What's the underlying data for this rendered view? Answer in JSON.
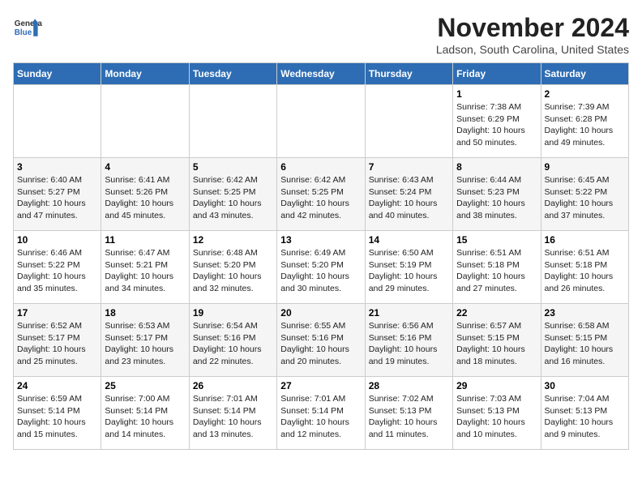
{
  "header": {
    "logo_line1": "General",
    "logo_line2": "Blue",
    "title": "November 2024",
    "subtitle": "Ladson, South Carolina, United States"
  },
  "calendar": {
    "days_of_week": [
      "Sunday",
      "Monday",
      "Tuesday",
      "Wednesday",
      "Thursday",
      "Friday",
      "Saturday"
    ],
    "weeks": [
      [
        {
          "day": "",
          "info": ""
        },
        {
          "day": "",
          "info": ""
        },
        {
          "day": "",
          "info": ""
        },
        {
          "day": "",
          "info": ""
        },
        {
          "day": "",
          "info": ""
        },
        {
          "day": "1",
          "info": "Sunrise: 7:38 AM\nSunset: 6:29 PM\nDaylight: 10 hours and 50 minutes."
        },
        {
          "day": "2",
          "info": "Sunrise: 7:39 AM\nSunset: 6:28 PM\nDaylight: 10 hours and 49 minutes."
        }
      ],
      [
        {
          "day": "3",
          "info": "Sunrise: 6:40 AM\nSunset: 5:27 PM\nDaylight: 10 hours and 47 minutes."
        },
        {
          "day": "4",
          "info": "Sunrise: 6:41 AM\nSunset: 5:26 PM\nDaylight: 10 hours and 45 minutes."
        },
        {
          "day": "5",
          "info": "Sunrise: 6:42 AM\nSunset: 5:25 PM\nDaylight: 10 hours and 43 minutes."
        },
        {
          "day": "6",
          "info": "Sunrise: 6:42 AM\nSunset: 5:25 PM\nDaylight: 10 hours and 42 minutes."
        },
        {
          "day": "7",
          "info": "Sunrise: 6:43 AM\nSunset: 5:24 PM\nDaylight: 10 hours and 40 minutes."
        },
        {
          "day": "8",
          "info": "Sunrise: 6:44 AM\nSunset: 5:23 PM\nDaylight: 10 hours and 38 minutes."
        },
        {
          "day": "9",
          "info": "Sunrise: 6:45 AM\nSunset: 5:22 PM\nDaylight: 10 hours and 37 minutes."
        }
      ],
      [
        {
          "day": "10",
          "info": "Sunrise: 6:46 AM\nSunset: 5:22 PM\nDaylight: 10 hours and 35 minutes."
        },
        {
          "day": "11",
          "info": "Sunrise: 6:47 AM\nSunset: 5:21 PM\nDaylight: 10 hours and 34 minutes."
        },
        {
          "day": "12",
          "info": "Sunrise: 6:48 AM\nSunset: 5:20 PM\nDaylight: 10 hours and 32 minutes."
        },
        {
          "day": "13",
          "info": "Sunrise: 6:49 AM\nSunset: 5:20 PM\nDaylight: 10 hours and 30 minutes."
        },
        {
          "day": "14",
          "info": "Sunrise: 6:50 AM\nSunset: 5:19 PM\nDaylight: 10 hours and 29 minutes."
        },
        {
          "day": "15",
          "info": "Sunrise: 6:51 AM\nSunset: 5:18 PM\nDaylight: 10 hours and 27 minutes."
        },
        {
          "day": "16",
          "info": "Sunrise: 6:51 AM\nSunset: 5:18 PM\nDaylight: 10 hours and 26 minutes."
        }
      ],
      [
        {
          "day": "17",
          "info": "Sunrise: 6:52 AM\nSunset: 5:17 PM\nDaylight: 10 hours and 25 minutes."
        },
        {
          "day": "18",
          "info": "Sunrise: 6:53 AM\nSunset: 5:17 PM\nDaylight: 10 hours and 23 minutes."
        },
        {
          "day": "19",
          "info": "Sunrise: 6:54 AM\nSunset: 5:16 PM\nDaylight: 10 hours and 22 minutes."
        },
        {
          "day": "20",
          "info": "Sunrise: 6:55 AM\nSunset: 5:16 PM\nDaylight: 10 hours and 20 minutes."
        },
        {
          "day": "21",
          "info": "Sunrise: 6:56 AM\nSunset: 5:16 PM\nDaylight: 10 hours and 19 minutes."
        },
        {
          "day": "22",
          "info": "Sunrise: 6:57 AM\nSunset: 5:15 PM\nDaylight: 10 hours and 18 minutes."
        },
        {
          "day": "23",
          "info": "Sunrise: 6:58 AM\nSunset: 5:15 PM\nDaylight: 10 hours and 16 minutes."
        }
      ],
      [
        {
          "day": "24",
          "info": "Sunrise: 6:59 AM\nSunset: 5:14 PM\nDaylight: 10 hours and 15 minutes."
        },
        {
          "day": "25",
          "info": "Sunrise: 7:00 AM\nSunset: 5:14 PM\nDaylight: 10 hours and 14 minutes."
        },
        {
          "day": "26",
          "info": "Sunrise: 7:01 AM\nSunset: 5:14 PM\nDaylight: 10 hours and 13 minutes."
        },
        {
          "day": "27",
          "info": "Sunrise: 7:01 AM\nSunset: 5:14 PM\nDaylight: 10 hours and 12 minutes."
        },
        {
          "day": "28",
          "info": "Sunrise: 7:02 AM\nSunset: 5:13 PM\nDaylight: 10 hours and 11 minutes."
        },
        {
          "day": "29",
          "info": "Sunrise: 7:03 AM\nSunset: 5:13 PM\nDaylight: 10 hours and 10 minutes."
        },
        {
          "day": "30",
          "info": "Sunrise: 7:04 AM\nSunset: 5:13 PM\nDaylight: 10 hours and 9 minutes."
        }
      ]
    ]
  }
}
